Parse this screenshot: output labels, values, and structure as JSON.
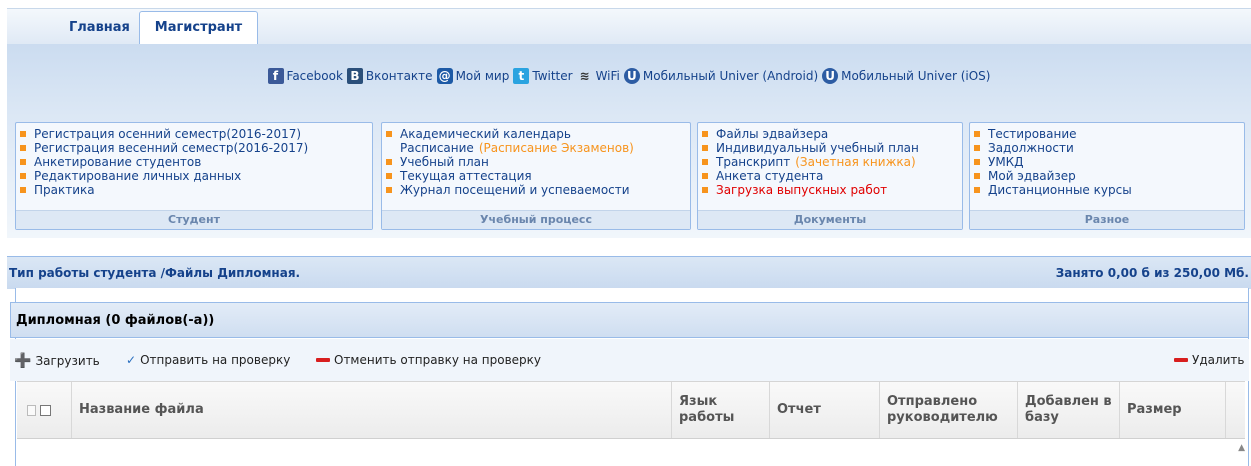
{
  "tabs": {
    "home": "Главная",
    "master": "Магистрант"
  },
  "social": [
    {
      "icon": "facebook-icon",
      "glyph": "f",
      "cls": "fb",
      "label": "Facebook"
    },
    {
      "icon": "vkontakte-icon",
      "glyph": "B",
      "cls": "vk",
      "label": "Вконтакте"
    },
    {
      "icon": "moi-mir-icon",
      "glyph": "@",
      "cls": "mm",
      "label": "Мой мир"
    },
    {
      "icon": "twitter-icon",
      "glyph": "t",
      "cls": "tw",
      "label": "Twitter"
    },
    {
      "icon": "wifi-icon",
      "glyph": "≋",
      "cls": "wf",
      "label": "WiFi"
    },
    {
      "icon": "univer-android-icon",
      "glyph": "U",
      "cls": "un",
      "label": "Мобильный Univer (Android)"
    },
    {
      "icon": "univer-ios-icon",
      "glyph": "U",
      "cls": "un",
      "label": "Мобильный Univer (iOS)"
    }
  ],
  "groups": [
    {
      "footer": "Студент",
      "items": [
        {
          "label": "Регистрация осенний семестр(2016-2017)"
        },
        {
          "label": "Регистрация весенний семестр(2016-2017)"
        },
        {
          "label": "Анкетирование студентов"
        },
        {
          "label": "Редактирование личных данных"
        },
        {
          "label": "Практика"
        }
      ]
    },
    {
      "footer": "Учебный процесс",
      "items": [
        {
          "label": "Академический календарь"
        },
        {
          "label": "Расписание",
          "extra": "(Расписание Экзаменов)",
          "nosq": true
        },
        {
          "label": "Учебный план"
        },
        {
          "label": "Текущая аттестация"
        },
        {
          "label": "Журнал посещений и успеваемости"
        }
      ]
    },
    {
      "footer": "Документы",
      "items": [
        {
          "label": "Файлы эдвайзера"
        },
        {
          "label": "Индивидуальный учебный план"
        },
        {
          "label": "Транскрипт",
          "extra": "(Зачетная книжка)"
        },
        {
          "label": "Анкета студента"
        },
        {
          "label": "Загрузка выпускных работ",
          "red": true
        }
      ]
    },
    {
      "footer": "Разное",
      "items": [
        {
          "label": "Тестирование"
        },
        {
          "label": "Задолжности"
        },
        {
          "label": "УМКД"
        },
        {
          "label": "Мой эдвайзер"
        },
        {
          "label": "Дистанционные курсы"
        }
      ]
    }
  ],
  "main": {
    "title": "Тип работы студента /Файлы Дипломная.",
    "quota": "Занято 0,00 б из 250,00 Мб.",
    "panel_title": "Дипломная (0 файлов(-а))"
  },
  "toolbar": {
    "upload": "Загрузить",
    "send": "Отправить на проверку",
    "cancel": "Отменить отправку на проверку",
    "delete": "Удалить"
  },
  "columns": {
    "name": "Название файла",
    "lang": "Язык работы",
    "report": "Отчет",
    "sent": "Отправлено руководителю",
    "added": "Добавлен в базу",
    "size": "Размер"
  },
  "colors": {
    "accent": "#15428b",
    "bullet": "#f7941d",
    "alert": "#e00000"
  }
}
